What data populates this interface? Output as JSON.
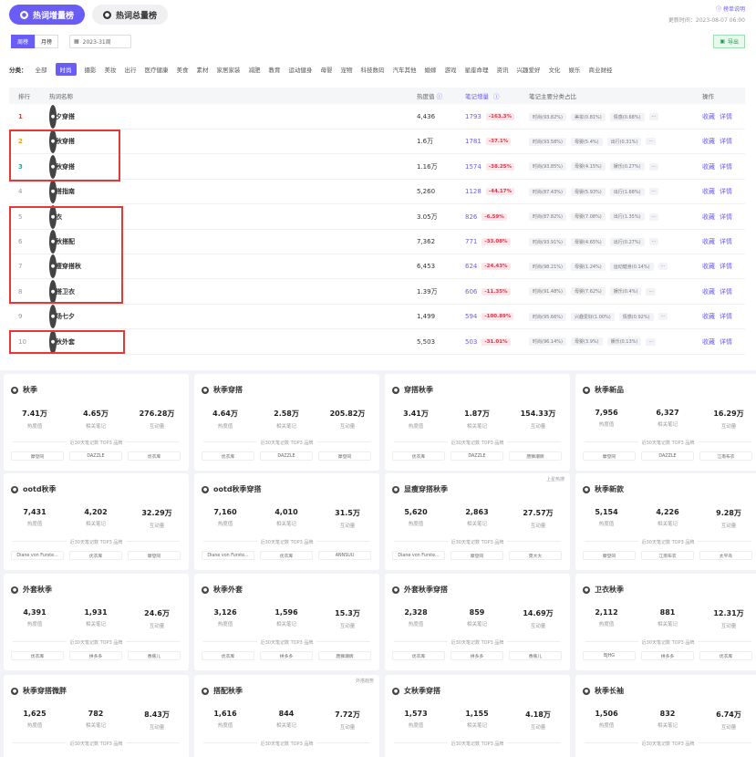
{
  "tabs": [
    {
      "label": "热词增量榜"
    },
    {
      "label": "热词总量榜"
    }
  ],
  "help": "榜单说明",
  "update_time": "更新时间：2023-08-07 06:00",
  "period": {
    "options": [
      "周榜",
      "月榜"
    ],
    "selected": "周榜",
    "date": "2023-31周"
  },
  "export_label": "导出",
  "categories": {
    "label": "分类：",
    "items": [
      "全部",
      "时尚",
      "摄影",
      "美妆",
      "出行",
      "医疗健康",
      "美食",
      "素材",
      "家居家装",
      "减肥",
      "教育",
      "运动健身",
      "母婴",
      "宠物",
      "科技数码",
      "汽车其他",
      "婚嫁",
      "游戏",
      "星座命理",
      "资讯",
      "兴趣爱好",
      "文化",
      "娱乐",
      "商业财经"
    ],
    "selected": "时尚"
  },
  "table": {
    "headers": {
      "rank": "排行",
      "word": "热词名称",
      "heat": "热度值",
      "notes": "笔记增量",
      "dist": "笔记主要分类占比",
      "ops": "操作"
    },
    "ops": {
      "fav": "收藏",
      "detail": "详情"
    },
    "more": "···",
    "rows": [
      {
        "rank": "1",
        "word": "七夕穿搭",
        "heat": "4,436",
        "notes": "1793",
        "delta": "-163.3%",
        "dist": [
          "时尚(93.82%)",
          "美妆(0.81%)",
          "情感(0.68%)"
        ]
      },
      {
        "rank": "2",
        "word": "初秋穿搭",
        "heat": "1.6万",
        "notes": "1781",
        "delta": "-37.1%",
        "dist": [
          "时尚(93.58%)",
          "母婴(5.4%)",
          "出行(0.31%)"
        ]
      },
      {
        "rank": "3",
        "word": "早秋穿搭",
        "heat": "1.16万",
        "notes": "1574",
        "delta": "-38.25%",
        "dist": [
          "时尚(93.85%)",
          "母婴(4.15%)",
          "娱乐(0.27%)"
        ]
      },
      {
        "rank": "4",
        "word": "穿搭指南",
        "heat": "5,260",
        "notes": "1128",
        "delta": "-44.17%",
        "dist": [
          "时尚(87.43%)",
          "母婴(5.93%)",
          "出行(1.68%)"
        ]
      },
      {
        "rank": "5",
        "word": "卫衣",
        "heat": "3.05万",
        "notes": "826",
        "delta": "-6.59%",
        "dist": [
          "时尚(87.82%)",
          "母婴(7.08%)",
          "出行(1.35%)"
        ]
      },
      {
        "rank": "6",
        "word": "初秋搭配",
        "heat": "7,362",
        "notes": "771",
        "delta": "-33.08%",
        "dist": [
          "时尚(93.91%)",
          "母婴(4.65%)",
          "出行(0.27%)"
        ]
      },
      {
        "rank": "7",
        "word": "显瘦穿搭秋",
        "heat": "6,453",
        "notes": "624",
        "delta": "-24.43%",
        "dist": [
          "时尚(98.21%)",
          "母婴(1.24%)",
          "运动健身(0.14%)"
        ]
      },
      {
        "rank": "8",
        "word": "穿搭卫衣",
        "heat": "1.39万",
        "notes": "606",
        "delta": "-11.35%",
        "dist": [
          "时尚(91.48%)",
          "母婴(7.62%)",
          "娱乐(0.4%)"
        ]
      },
      {
        "rank": "9",
        "word": "现场七夕",
        "heat": "1,499",
        "notes": "594",
        "delta": "-100.89%",
        "dist": [
          "时尚(95.66%)",
          "兴趣爱好(1.00%)",
          "情感(0.92%)"
        ]
      },
      {
        "rank": "10",
        "word": "早秋外套",
        "heat": "5,503",
        "notes": "503",
        "delta": "-31.01%",
        "dist": [
          "时尚(96.14%)",
          "母婴(3.9%)",
          "娱乐(0.13%)"
        ]
      }
    ]
  },
  "card_labels": {
    "heat": "热度值",
    "notes": "相关笔记",
    "inter": "互动量",
    "top3": "近30天笔记数 TOP3 品牌"
  },
  "cards": [
    {
      "title": "秋季",
      "badge": "",
      "heat": "7.41万",
      "notes": "4.65万",
      "inter": "276.28万",
      "brands": [
        "摩登同",
        "DAZZLE",
        "优衣库"
      ]
    },
    {
      "title": "秋季穿搭",
      "badge": "",
      "heat": "4.64万",
      "notes": "2.58万",
      "inter": "205.82万",
      "brands": [
        "优衣库",
        "DAZZLE",
        "摩登同"
      ]
    },
    {
      "title": "穿搭秋季",
      "badge": "",
      "heat": "3.41万",
      "notes": "1.87万",
      "inter": "154.33万",
      "brands": [
        "优衣库",
        "DAZZLE",
        "唐狮潮牌"
      ]
    },
    {
      "title": "秋季新品",
      "badge": "",
      "heat": "7,956",
      "notes": "6,327",
      "inter": "16.29万",
      "brands": [
        "摩登同",
        "DAZZLE",
        "江南布衣"
      ]
    },
    {
      "title": "ootd秋季",
      "badge": "",
      "heat": "7,431",
      "notes": "4,202",
      "inter": "32.29万",
      "brands": [
        "Diane von Furste...",
        "优衣库",
        "摩登同"
      ]
    },
    {
      "title": "ootd秋季穿搭",
      "badge": "",
      "heat": "7,160",
      "notes": "4,010",
      "inter": "31.5万",
      "brands": [
        "Diane von Furste...",
        "优衣库",
        "ANNSUU"
      ]
    },
    {
      "title": "显瘦穿搭秋季",
      "badge": "上星热搜",
      "heat": "5,620",
      "notes": "2,863",
      "inter": "27.57万",
      "brands": [
        "Diane von Furste...",
        "摩登同",
        "莫大大"
      ]
    },
    {
      "title": "秋季新款",
      "badge": "",
      "heat": "5,154",
      "notes": "4,226",
      "inter": "9.28万",
      "brands": [
        "摩登同",
        "江南布衣",
        "太平鸟"
      ]
    },
    {
      "title": "外套秋季",
      "badge": "",
      "heat": "4,391",
      "notes": "1,931",
      "inter": "24.6万",
      "brands": [
        "优衣库",
        "拼多多",
        "香蕉儿"
      ]
    },
    {
      "title": "秋季外套",
      "badge": "",
      "heat": "3,126",
      "notes": "1,596",
      "inter": "15.3万",
      "brands": [
        "优衣库",
        "拼多多",
        "唐狮潮牌"
      ]
    },
    {
      "title": "外套秋季穿搭",
      "badge": "",
      "heat": "2,328",
      "notes": "859",
      "inter": "14.69万",
      "brands": [
        "优衣库",
        "拼多多",
        "香蕉儿"
      ]
    },
    {
      "title": "卫衣秋季",
      "badge": "",
      "heat": "2,112",
      "notes": "881",
      "inter": "12.31万",
      "brands": [
        "BJHG",
        "拼多多",
        "优衣库"
      ]
    },
    {
      "title": "秋季穿搭微胖",
      "badge": "",
      "heat": "1,625",
      "notes": "782",
      "inter": "8.43万",
      "brands": []
    },
    {
      "title": "搭配秋季",
      "badge": "外搭趋势",
      "heat": "1,616",
      "notes": "844",
      "inter": "7.72万",
      "brands": []
    },
    {
      "title": "女秋季穿搭",
      "badge": "",
      "heat": "1,573",
      "notes": "1,155",
      "inter": "4.18万",
      "brands": []
    },
    {
      "title": "秋季长袖",
      "badge": "",
      "heat": "1,506",
      "notes": "832",
      "inter": "6.74万",
      "brands": []
    }
  ],
  "colors": {
    "accent": "#6a5cf6",
    "negative": "#e0354a",
    "highlight": "#e53935",
    "rank1": "#e53935",
    "rank2": "#f39c12",
    "rank3": "#26a69a"
  }
}
